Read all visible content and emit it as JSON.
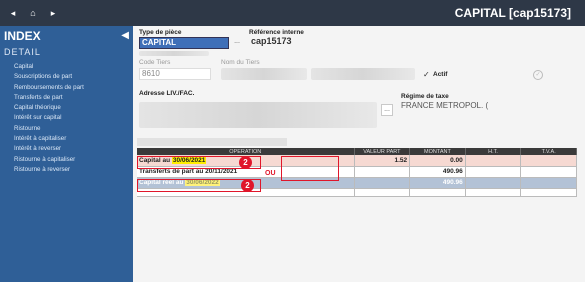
{
  "topbar": {
    "nav_back": "◂",
    "nav_home": "⌂",
    "nav_forward": "▸",
    "title": "CAPITAL [cap15173]"
  },
  "sidebar": {
    "header": "INDEX",
    "collapse": "◀",
    "section": "DETAIL",
    "items": [
      "Capital",
      "Souscriptions de part",
      "Remboursements de part",
      "Transferts de part",
      "Capital théorique",
      "Intérêt sur capital",
      "Ristourne",
      "Intérêt à capitaliser",
      "Intérêt à reverser",
      "Ristourne à capitaliser",
      "Ristourne à reverser"
    ]
  },
  "form": {
    "type_piece_label": "Type de pièce",
    "type_piece_value": "CAPITAL",
    "type_piece_btn": "...",
    "ref_interne_label": "Référence interne",
    "ref_interne_value": "cap15173",
    "code_tiers_label": "Code Tiers",
    "code_tiers_value": "8610",
    "nom_tiers_label": "Nom du Tiers",
    "actif_label": "Actif",
    "adresse_label": "Adresse LIV./FAC.",
    "regime_label": "Régime de taxe",
    "regime_value": "FRANCE METROPOL. (",
    "addr_btn": "..."
  },
  "table": {
    "headers": [
      "OPERATION",
      "VALEUR PART",
      "MONTANT",
      "H.T.",
      "T.V.A."
    ],
    "rows": [
      {
        "op_prefix": "Capital au ",
        "op_date": "30/06/2021",
        "valeur": "1.52",
        "montant": "0.00",
        "ht": "",
        "tva": ""
      },
      {
        "op_prefix": "Transferts de part au 20/11/2021",
        "op_date": "",
        "valeur": "",
        "montant": "490.96",
        "ht": "",
        "tva": ""
      },
      {
        "op_prefix": "Capital réel au ",
        "op_date": "30/06/2022",
        "valeur": "",
        "montant": "490.96",
        "ht": "",
        "tva": ""
      }
    ]
  },
  "annotations": {
    "badge1": "2",
    "badge2": "2",
    "ou": "OU"
  },
  "colors": {
    "topbar": "#2e3847",
    "sidebar": "#2f5f97",
    "accent_red": "#e0162a",
    "highlight": "#ffee00"
  }
}
